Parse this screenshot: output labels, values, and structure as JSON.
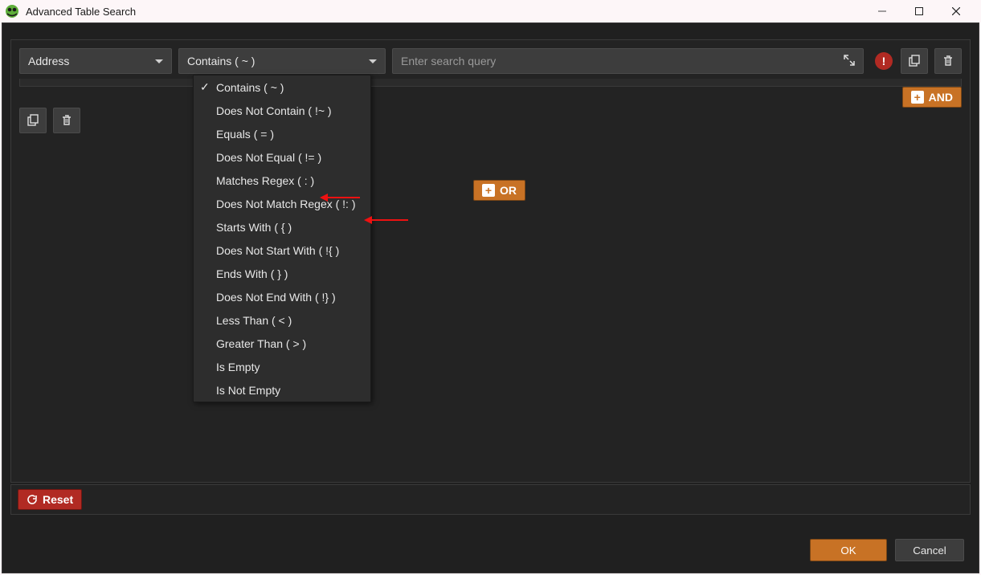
{
  "window": {
    "title": "Advanced Table Search"
  },
  "row1": {
    "field_selected": "Address",
    "operator_selected": "Contains ( ~ )",
    "search_placeholder": "Enter search query"
  },
  "operators": [
    "Contains ( ~ )",
    "Does Not Contain ( !~ )",
    "Equals ( = )",
    "Does Not Equal ( != )",
    "Matches Regex ( : )",
    "Does Not Match Regex ( !: )",
    "Starts With ( { )",
    "Does Not Start With ( !{ )",
    "Ends With ( } )",
    "Does Not End With ( !} )",
    "Less Than ( < )",
    "Greater Than ( > )",
    "Is Empty",
    "Is Not Empty"
  ],
  "operator_selected_index": 0,
  "annotation_arrow_targets": [
    4,
    5
  ],
  "buttons": {
    "and": "AND",
    "or": "OR",
    "reset": "Reset",
    "ok": "OK",
    "cancel": "Cancel"
  },
  "colors": {
    "accent": "#c87225",
    "danger": "#b12a23"
  }
}
